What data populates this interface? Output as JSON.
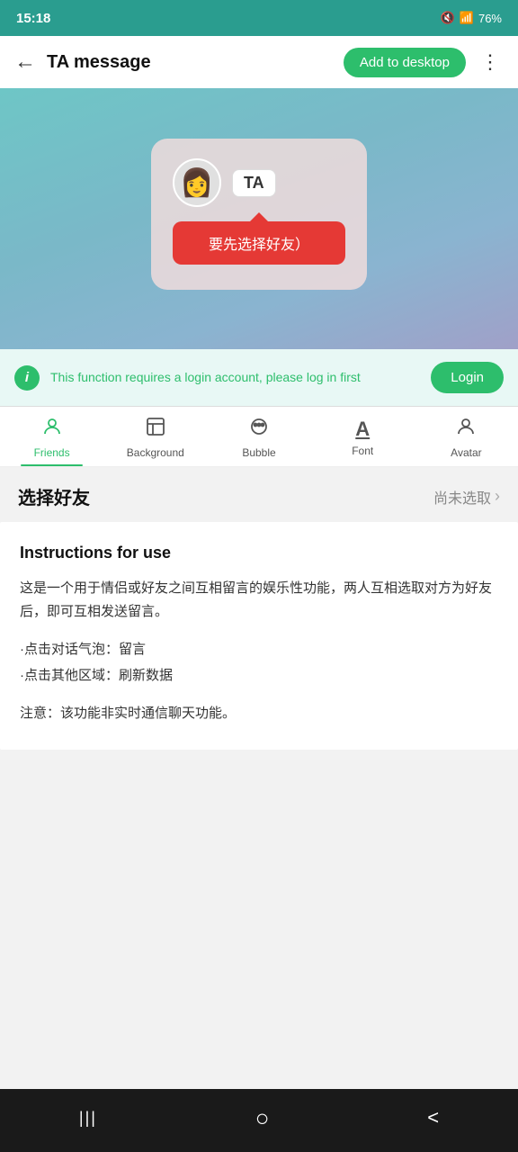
{
  "statusBar": {
    "time": "15:18",
    "battery": "76%",
    "batteryIcon": "🔋"
  },
  "header": {
    "backIcon": "←",
    "title": "TA message",
    "addToDesktopLabel": "Add to desktop",
    "moreIcon": "⋮"
  },
  "heroCard": {
    "avatarEmoji": "👩",
    "taBadge": "TA",
    "bubbleText": "要先选择好友）"
  },
  "loginBanner": {
    "infoIcon": "i",
    "text": "This function requires a login account, please log in first",
    "loginLabel": "Login"
  },
  "tabs": [
    {
      "id": "friends",
      "icon": "👤",
      "label": "Friends",
      "active": true
    },
    {
      "id": "background",
      "icon": "🖼",
      "label": "Background",
      "active": false
    },
    {
      "id": "bubble",
      "icon": "🎨",
      "label": "Bubble",
      "active": false
    },
    {
      "id": "font",
      "icon": "A",
      "label": "Font",
      "active": false
    },
    {
      "id": "avatar",
      "icon": "👤",
      "label": "Avatar",
      "active": false
    }
  ],
  "selectFriend": {
    "label": "选择好友",
    "value": "尚未选取",
    "chevron": "›"
  },
  "instructions": {
    "title": "Instructions for use",
    "body": "这是一个用于情侣或好友之间互相留言的娱乐性功能，两人互相选取对方为好友后，即可互相发送留言。",
    "tips": "·点击对话气泡：留言\n·点击其他区域：刷新数据",
    "note": "注意：该功能非实时通信聊天功能。"
  },
  "bottomNav": {
    "backBtn": "|||",
    "homeBtn": "○",
    "prevBtn": "<"
  }
}
